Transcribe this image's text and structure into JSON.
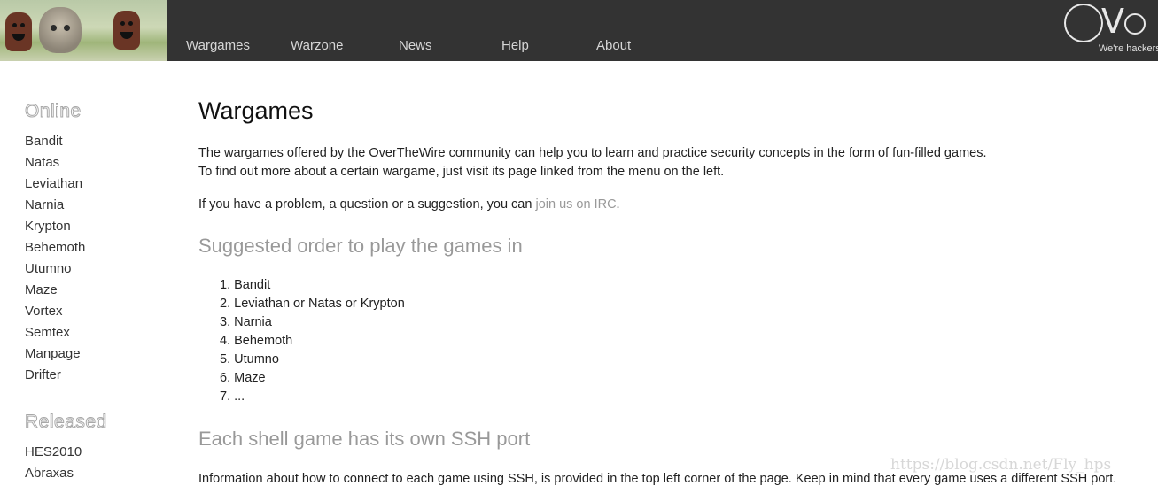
{
  "header": {
    "nav": [
      "Wargames",
      "Warzone",
      "News",
      "Help",
      "About"
    ],
    "logo_text": "Ove",
    "logo_tagline": "We're hackers"
  },
  "sidebar": {
    "online_heading": "Online",
    "online_items": [
      "Bandit",
      "Natas",
      "Leviathan",
      "Narnia",
      "Krypton",
      "Behemoth",
      "Utumno",
      "Maze",
      "Vortex",
      "Semtex",
      "Manpage",
      "Drifter"
    ],
    "released_heading": "Released",
    "released_items": [
      "HES2010",
      "Abraxas"
    ]
  },
  "main": {
    "title": "Wargames",
    "intro_line1": "The wargames offered by the OverTheWire community can help you to learn and practice security concepts in the form of fun-filled games.",
    "intro_line2": "To find out more about a certain wargame, just visit its page linked from the menu on the left.",
    "problem_before": "If you have a problem, a question or a suggestion, you can ",
    "problem_link": "join us on IRC",
    "problem_after": ".",
    "order_heading": "Suggested order to play the games in",
    "order_items": [
      "Bandit",
      "Leviathan or Natas or Krypton",
      "Narnia",
      "Behemoth",
      "Utumno",
      "Maze",
      "..."
    ],
    "ssh_heading": "Each shell game has its own SSH port",
    "ssh_text": "Information about how to connect to each game using SSH, is provided in the top left corner of the page. Keep in mind that every game uses a different SSH port."
  },
  "watermark": "https://blog.csdn.net/Fly_hps",
  "colors": {
    "topbar": "#333333",
    "link": "#999999",
    "heading_grey": "#999999"
  }
}
